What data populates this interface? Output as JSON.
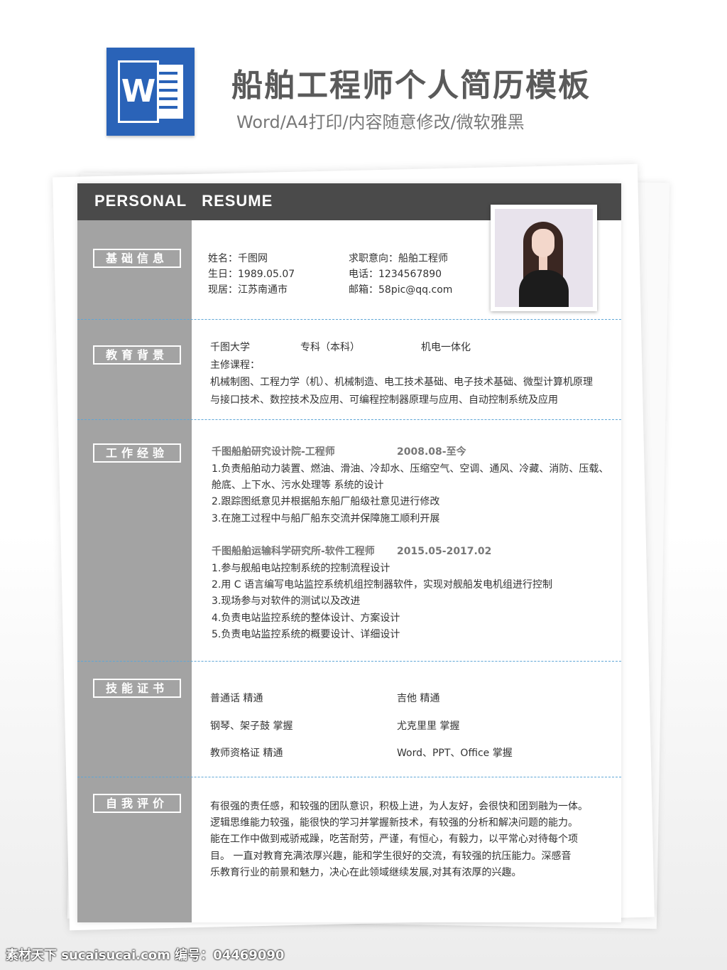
{
  "header": {
    "logo_letter": "W",
    "title": "船舶工程师个人简历模板",
    "subtitle": "Word/A4打印/内容随意修改/微软雅黑"
  },
  "resume": {
    "banner": "PERSONAL   RESUME",
    "basic": {
      "label": "基础信息",
      "name": "姓名：千图网",
      "birth": "生日：1989.05.07",
      "residence": "现居：江苏南通市",
      "intent": "求职意向：船舶工程师",
      "phone": "电话：1234567890",
      "email": "邮箱：58pic@qq.com"
    },
    "education": {
      "label": "教育背景",
      "school": "千图大学",
      "degree": "专科（本科）",
      "major": "机电一体化",
      "courses_title": "主修课程：",
      "courses_line1": "机械制图、工程力学（机）、机械制造、电工技术基础、电子技术基础、微型计算机原理",
      "courses_line2": "与接口技术、数控技术及应用、可编程控制器原理与应用、自动控制系统及应用"
    },
    "work": {
      "label": "工作经验",
      "jobs": [
        {
          "title": "千图船舶研究设计院-工程师",
          "date": "2008.08-至今",
          "lines": [
            "1.负责船舶动力装置、燃油、滑油、冷却水、压缩空气、空调、通风、冷藏、消防、压载、",
            "舱底、上下水、污水处理等  系统的设计",
            "2.跟踪图纸意见并根据船东船厂船级社意见进行修改",
            "3.在施工过程中与船厂船东交流并保障施工顺利开展"
          ]
        },
        {
          "title": "千图船舶运输科学研究所-软件工程师",
          "date": "2015.05-2017.02",
          "lines": [
            "1.参与舰船电站控制系统的控制流程设计",
            "2.用 C 语言编写电站监控系统机组控制器软件，实现对舰船发电机组进行控制",
            "3.现场参与对软件的测试以及改进",
            "4.负责电站监控系统的整体设计、方案设计",
            "5.负责电站监控系统的概要设计、详细设计"
          ]
        }
      ]
    },
    "skills": {
      "label": "技能证书",
      "items": [
        "普通话    精通",
        "吉他    精通",
        "钢琴、架子鼓    掌握",
        "尤克里里    掌握",
        "教师资格证    精通",
        "Word、PPT、Office    掌握"
      ]
    },
    "self": {
      "label": "自我评价",
      "lines": [
        "有很强的责任感，和较强的团队意识，积极上进，为人友好，会很快和团到融为一体。",
        "逻辑思维能力较强，能很快的学习并掌握新技术，有较强的分析和解决问题的能力。",
        "能在工作中做到戒骄戒躁，吃苦耐劳，严谨，有恒心，有毅力，以平常心对待每个项",
        "目。  一直对教育充满浓厚兴趣，能和学生很好的交流，有较强的抗压能力。深感音",
        "乐教育行业的前景和魅力，决心在此领域继续发展,对其有浓厚的兴趣。"
      ]
    }
  },
  "footer": {
    "watermark": "素材天下 sucaisucai.com  编号：04469090"
  }
}
